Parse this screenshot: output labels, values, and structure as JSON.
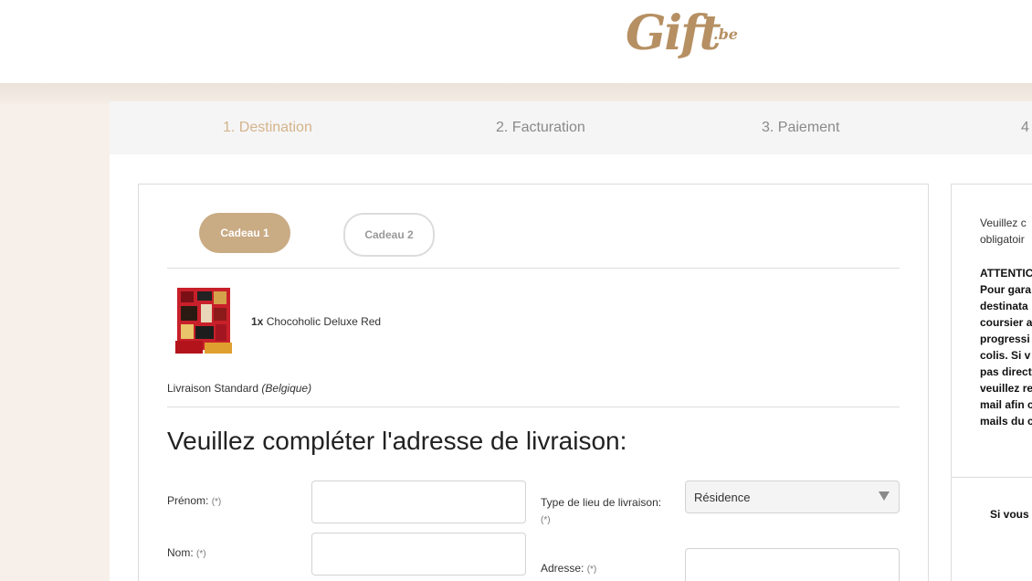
{
  "brand": {
    "logo_text": "Gift",
    "logo_suffix": ".be",
    "color": "#b69063"
  },
  "steps": [
    {
      "label": "1. Destination",
      "active": true
    },
    {
      "label": "2. Facturation",
      "active": false
    },
    {
      "label": "3. Paiement",
      "active": false
    },
    {
      "label": "4",
      "active": false
    }
  ],
  "gift_tabs": [
    {
      "label": "Cadeau 1",
      "active": true
    },
    {
      "label": "Cadeau 2",
      "active": false
    }
  ],
  "product": {
    "quantity": "1x",
    "name": "Chocoholic Deluxe Red"
  },
  "shipping": {
    "method": "Livraison Standard",
    "country": "(Belgique)"
  },
  "form": {
    "heading": "Veuillez compléter l'adresse de livraison:",
    "required_mark": "(*)",
    "first_name_label": "Prénom:",
    "first_name_value": "",
    "last_name_label": "Nom:",
    "last_name_value": "",
    "location_type_label": "Type de lieu de livraison:",
    "location_type_value": "Résidence",
    "address_label": "Adresse:",
    "address_value": ""
  },
  "side_panel": {
    "intro_lines": [
      "Veuillez c",
      "obligatoir"
    ],
    "attention_lines": [
      "ATTENTIC",
      "Pour gara",
      "destinata",
      "coursier a",
      "progressi",
      "colis. Si v",
      "pas direct",
      "veuillez re",
      "mail afin c",
      "mails du c"
    ],
    "bottom_text": "Si vous"
  },
  "colors": {
    "accent": "#c9ab84",
    "active_step": "#d4b48c",
    "page_bg": "#f7f0ea"
  }
}
